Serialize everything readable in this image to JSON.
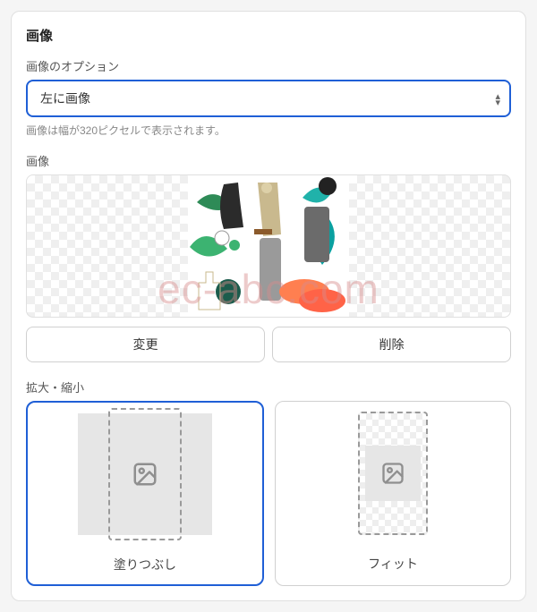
{
  "section": {
    "title": "画像"
  },
  "options": {
    "label": "画像のオプション",
    "selected": "左に画像",
    "helper": "画像は幅が320ピクセルで表示されます。"
  },
  "preview": {
    "label": "画像",
    "watermark": "ec-abc.com"
  },
  "buttons": {
    "change": "変更",
    "delete": "削除"
  },
  "scale": {
    "label": "拡大・縮小",
    "fill": "塗りつぶし",
    "fit": "フィット",
    "selected": "fill"
  }
}
